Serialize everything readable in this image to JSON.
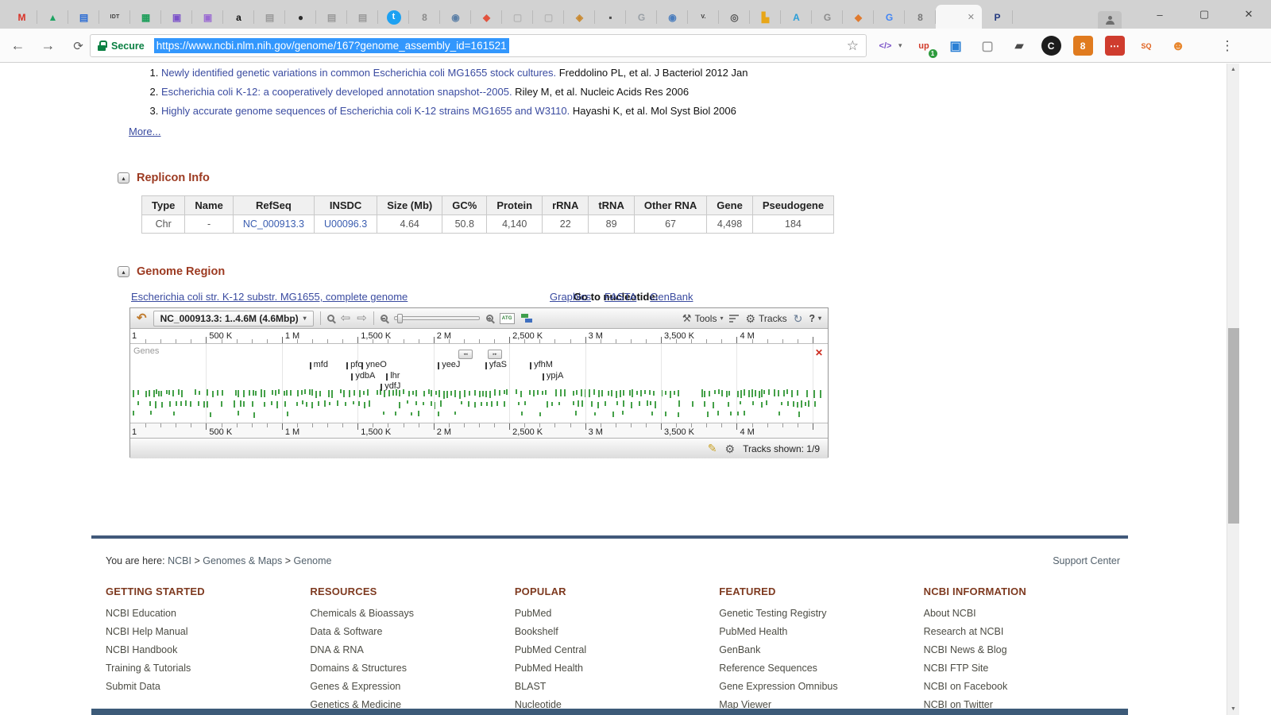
{
  "icons": {
    "undo": "↶",
    "back": "⇦",
    "forward": "⇨",
    "refresh": "↻",
    "help": "?",
    "caret": "▾",
    "pen": "✎",
    "gear": "⚙",
    "tools": "⚒",
    "close": "✕",
    "pan_left": "◂◂",
    "pan_right": "▸▸",
    "star": "☆",
    "menu": "⋮",
    "nav_back": "←",
    "nav_forward": "→",
    "nav_reload": "⟳",
    "atg": "ATG",
    "up_arrow": "▲",
    "down_arrow": "▼",
    "collapse": "▴"
  },
  "browser": {
    "window_controls": {
      "minimize": "–",
      "maximize": "▢",
      "close": "✕"
    },
    "omnibox": {
      "secure_label": "Secure",
      "url": "https://www.ncbi.nlm.nih.gov/genome/167?genome_assembly_id=161521"
    },
    "tabs": [
      {
        "name": "gmail",
        "glyph": "M",
        "color": "#d93025"
      },
      {
        "name": "drive",
        "glyph": "▲",
        "color": "#1ea362"
      },
      {
        "name": "docs-blue",
        "glyph": "▤",
        "color": "#2b6cd4"
      },
      {
        "name": "idt",
        "glyph": "IDT",
        "color": "#3d3d3d",
        "small": true
      },
      {
        "name": "sheets",
        "glyph": "▦",
        "color": "#1e9e5a"
      },
      {
        "name": "photo-1",
        "glyph": "▣",
        "color": "#7b51c9"
      },
      {
        "name": "photo-2",
        "glyph": "▣",
        "color": "#9a6ad2"
      },
      {
        "name": "amazon",
        "glyph": "a",
        "color": "#141414"
      },
      {
        "name": "doc-gray",
        "glyph": "▤",
        "color": "#9a9a9a"
      },
      {
        "name": "black-circle",
        "glyph": "●",
        "color": "#2b2b2b"
      },
      {
        "name": "doc-gray-2",
        "glyph": "▤",
        "color": "#9a9a9a"
      },
      {
        "name": "doc-gray-3",
        "glyph": "▤",
        "color": "#9a9a9a"
      },
      {
        "name": "twitter",
        "glyph": "t",
        "color": "#ffffff",
        "bg": "#1da1f2"
      },
      {
        "name": "gray-eight",
        "glyph": "8",
        "color": "#8a8a8a"
      },
      {
        "name": "compass",
        "glyph": "◉",
        "color": "#5b7fa6"
      },
      {
        "name": "red-gem",
        "glyph": "◆",
        "color": "#e2533e"
      },
      {
        "name": "doc-light",
        "glyph": "▢",
        "color": "#b5b5b5"
      },
      {
        "name": "doc-light-2",
        "glyph": "▢",
        "color": "#b5b5b5"
      },
      {
        "name": "gold-gem",
        "glyph": "◈",
        "color": "#c9882d"
      },
      {
        "name": "dark-square",
        "glyph": "▪",
        "color": "#4a4a4a"
      },
      {
        "name": "g-gray",
        "glyph": "G",
        "color": "#9aa0a6"
      },
      {
        "name": "compass-blue",
        "glyph": "◉",
        "color": "#4a7dbd"
      },
      {
        "name": "v-site",
        "glyph": "V.",
        "color": "#333333",
        "small": true
      },
      {
        "name": "target",
        "glyph": "◎",
        "color": "#555555"
      },
      {
        "name": "chart-gold",
        "glyph": "▙",
        "color": "#e8a618"
      },
      {
        "name": "a-blue",
        "glyph": "A",
        "color": "#2a9ed8"
      },
      {
        "name": "g-gray-2",
        "glyph": "G",
        "color": "#8d8d8d"
      },
      {
        "name": "orange-gem",
        "glyph": "◆",
        "color": "#e07a2e"
      },
      {
        "name": "google",
        "glyph": "G",
        "color": "#4285f4"
      },
      {
        "name": "gray-curl",
        "glyph": "8",
        "color": "#777777"
      },
      {
        "name": "active",
        "active": true,
        "close": "✕"
      },
      {
        "name": "p-site",
        "glyph": "P",
        "color": "#253b80"
      }
    ],
    "extensions": [
      {
        "name": "code-embed",
        "glyph": "</>",
        "color": "#7a52c8",
        "caret": true,
        "size": 11
      },
      {
        "name": "up-red",
        "glyph": "up",
        "color": "#d23b2a",
        "badge": "1",
        "size": 11
      },
      {
        "name": "blue-grid",
        "glyph": "▣",
        "color": "#2a7fd4",
        "size": 16
      },
      {
        "name": "gray-page",
        "glyph": "▢",
        "color": "#9a9a9a",
        "size": 16
      },
      {
        "name": "pdf-dark",
        "glyph": "▰",
        "color": "#4a4a4a",
        "size": 14
      },
      {
        "name": "c-black",
        "glyph": "C",
        "color": "#ffffff",
        "bg": "#1d1d1d",
        "round": true,
        "size": 12
      },
      {
        "name": "orange-eight",
        "glyph": "8",
        "color": "#ffffff",
        "bg": "#e07b1f",
        "size": 12
      },
      {
        "name": "red-dots",
        "glyph": "⋯",
        "color": "#ffffff",
        "bg": "#cf3c2e",
        "size": 12
      },
      {
        "name": "seoquake",
        "glyph": "SQ",
        "color": "#e0621f",
        "size": 9
      },
      {
        "name": "orange-monster",
        "glyph": "☻",
        "color": "#e8872e",
        "size": 17
      }
    ]
  },
  "page": {
    "references": {
      "items": [
        {
          "title": "Newly identified genetic variations in common Escherichia coli MG1655 stock cultures.",
          "meta": "Freddolino PL, et al. J Bacteriol 2012 Jan"
        },
        {
          "title": "Escherichia coli K-12: a cooperatively developed annotation snapshot--2005.",
          "meta": "Riley M, et al. Nucleic Acids Res 2006"
        },
        {
          "title": "Highly accurate genome sequences of Escherichia coli K-12 strains MG1655 and W3110.",
          "meta": "Hayashi K, et al. Mol Syst Biol 2006"
        }
      ],
      "more_label": "More..."
    },
    "replicon": {
      "title": "Replicon Info",
      "columns": [
        "Type",
        "Name",
        "RefSeq",
        "INSDC",
        "Size (Mb)",
        "GC%",
        "Protein",
        "rRNA",
        "tRNA",
        "Other RNA",
        "Gene",
        "Pseudogene"
      ],
      "link_columns": [
        2,
        3
      ],
      "rows": [
        [
          "Chr",
          "-",
          "NC_000913.3",
          "U00096.3",
          "4.64",
          "50.8",
          "4,140",
          "22",
          "89",
          "67",
          "4,498",
          "184"
        ]
      ]
    },
    "genome_region": {
      "title": "Genome Region",
      "sequence_link": "Escherichia coli str. K-12 substr. MG1655, complete genome",
      "goto_label": "Go to nucleotide:",
      "goto_links": [
        "Graphics",
        "FASTA",
        "GenBank"
      ],
      "viewer": {
        "range_label": "NC_000913.3: 1..4.6M (4.6Mbp)",
        "tools_label": "Tools",
        "tracks_label": "Tracks",
        "tracks_shown": "Tracks shown: 1/9",
        "panel_label": "Genes",
        "origin_label": "1",
        "ruler_labels": [
          "500 K",
          "1 M",
          "1,500 K",
          "2 M",
          "2,500 K",
          "3 M",
          "3,500 K",
          "4 M"
        ],
        "total": 4600000,
        "step": 500000,
        "genes": [
          {
            "name": "mfd",
            "x": 25.7,
            "row": 0
          },
          {
            "name": "pfo",
            "x": 31.0,
            "row": 0
          },
          {
            "name": "yneO",
            "x": 33.2,
            "row": 0
          },
          {
            "name": "yeeJ",
            "x": 44.1,
            "row": 0
          },
          {
            "name": "yfaS",
            "x": 50.9,
            "row": 0
          },
          {
            "name": "yfhM",
            "x": 57.3,
            "row": 0
          },
          {
            "name": "ydbA",
            "x": 31.7,
            "row": 1
          },
          {
            "name": "lhr",
            "x": 36.7,
            "row": 1
          },
          {
            "name": "ypjA",
            "x": 59.1,
            "row": 1
          },
          {
            "name": "ydfJ",
            "x": 35.9,
            "row": 2
          }
        ]
      }
    },
    "breadcrumb": {
      "prefix": "You are here:",
      "links": [
        "NCBI",
        "Genomes & Maps",
        "Genome"
      ],
      "support": "Support Center"
    },
    "footer": {
      "columns": [
        {
          "title": "GETTING STARTED",
          "links": [
            "NCBI Education",
            "NCBI Help Manual",
            "NCBI Handbook",
            "Training & Tutorials",
            "Submit Data"
          ]
        },
        {
          "title": "RESOURCES",
          "links": [
            "Chemicals & Bioassays",
            "Data & Software",
            "DNA & RNA",
            "Domains & Structures",
            "Genes & Expression",
            "Genetics & Medicine"
          ]
        },
        {
          "title": "POPULAR",
          "links": [
            "PubMed",
            "Bookshelf",
            "PubMed Central",
            "PubMed Health",
            "BLAST",
            "Nucleotide"
          ]
        },
        {
          "title": "FEATURED",
          "links": [
            "Genetic Testing Registry",
            "PubMed Health",
            "GenBank",
            "Reference Sequences",
            "Gene Expression Omnibus",
            "Map Viewer"
          ]
        },
        {
          "title": "NCBI INFORMATION",
          "links": [
            "About NCBI",
            "Research at NCBI",
            "NCBI News & Blog",
            "NCBI FTP Site",
            "NCBI on Facebook",
            "NCBI on Twitter"
          ]
        }
      ]
    }
  }
}
